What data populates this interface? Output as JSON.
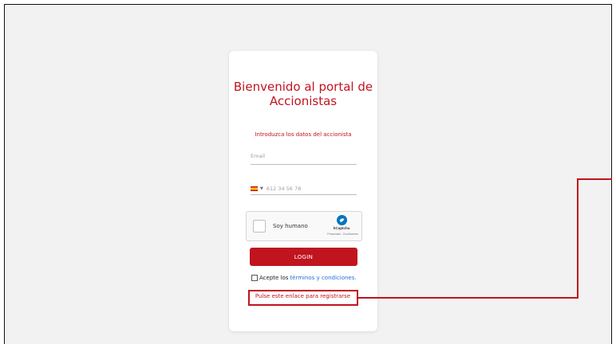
{
  "login_card": {
    "title": "Bienvenido al portal de Accionistas",
    "subtitle": "Introduzca los datos del accionista",
    "email_placeholder": "Email",
    "phone_placeholder": "612 34 56 78",
    "captcha": {
      "label": "Soy humano",
      "brand": "hCaptcha",
      "privacy": "Privacidad - Condiciones"
    },
    "login_label": "LOGIN",
    "terms_text": "Acepte los",
    "terms_link": "términos y condiciones.",
    "register_link": "Pulse este enlace para registrarse"
  },
  "colors": {
    "brand": "#c0141f",
    "link": "#1e6fd9",
    "background": "#f2f2f2"
  },
  "icons": [
    "spain-flag-icon",
    "chevron-down-icon",
    "hcaptcha-logo-icon"
  ]
}
